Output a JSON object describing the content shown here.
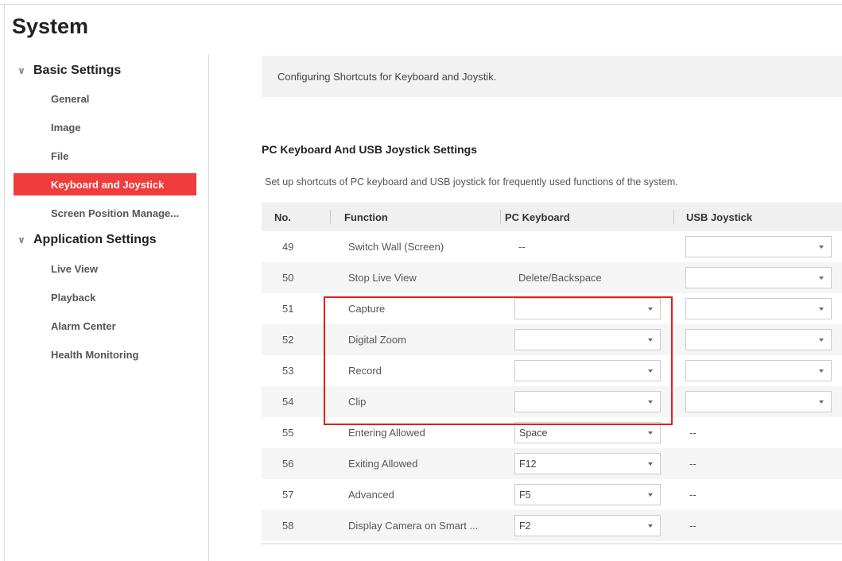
{
  "page": {
    "title": "System"
  },
  "sidebar": {
    "groups": [
      {
        "label": "Basic Settings",
        "items": [
          "General",
          "Image",
          "File",
          "Keyboard and Joystick",
          "Screen Position Manage..."
        ]
      },
      {
        "label": "Application Settings",
        "items": [
          "Live View",
          "Playback",
          "Alarm Center",
          "Health Monitoring"
        ]
      }
    ],
    "active_item": "Keyboard and Joystick"
  },
  "info": {
    "text": "Configuring Shortcuts for Keyboard and Joystik."
  },
  "section": {
    "title": "PC Keyboard And USB Joystick Settings",
    "description": "Set up shortcuts of PC keyboard and USB joystick for frequently used functions of the system."
  },
  "table": {
    "headers": [
      "No.",
      "Function",
      "PC Keyboard",
      "USB Joystick"
    ],
    "rows": [
      {
        "no": "49",
        "function": "Switch Wall (Screen)",
        "keyboard": {
          "type": "text",
          "value": "--"
        },
        "joystick": {
          "type": "select",
          "value": ""
        }
      },
      {
        "no": "50",
        "function": "Stop Live View",
        "keyboard": {
          "type": "text",
          "value": "Delete/Backspace"
        },
        "joystick": {
          "type": "select",
          "value": ""
        }
      },
      {
        "no": "51",
        "function": "Capture",
        "keyboard": {
          "type": "select",
          "value": ""
        },
        "joystick": {
          "type": "select",
          "value": ""
        }
      },
      {
        "no": "52",
        "function": "Digital Zoom",
        "keyboard": {
          "type": "select",
          "value": ""
        },
        "joystick": {
          "type": "select",
          "value": ""
        }
      },
      {
        "no": "53",
        "function": "Record",
        "keyboard": {
          "type": "select",
          "value": ""
        },
        "joystick": {
          "type": "select",
          "value": ""
        }
      },
      {
        "no": "54",
        "function": "Clip",
        "keyboard": {
          "type": "select",
          "value": ""
        },
        "joystick": {
          "type": "select",
          "value": ""
        }
      },
      {
        "no": "55",
        "function": "Entering Allowed",
        "keyboard": {
          "type": "select",
          "value": "Space"
        },
        "joystick": {
          "type": "text",
          "value": "--"
        }
      },
      {
        "no": "56",
        "function": "Exiting Allowed",
        "keyboard": {
          "type": "select",
          "value": "F12"
        },
        "joystick": {
          "type": "text",
          "value": "--"
        }
      },
      {
        "no": "57",
        "function": "Advanced",
        "keyboard": {
          "type": "select",
          "value": "F5"
        },
        "joystick": {
          "type": "text",
          "value": "--"
        }
      },
      {
        "no": "58",
        "function": "Display Camera on Smart ...",
        "keyboard": {
          "type": "select",
          "value": "F2"
        },
        "joystick": {
          "type": "text",
          "value": "--"
        }
      }
    ]
  },
  "colors": {
    "accent": "#f03c3c",
    "highlight_border": "#e41e1e"
  },
  "icons": {
    "group_toggle": "chevron-down-icon",
    "select_caret": "caret-down-icon"
  }
}
